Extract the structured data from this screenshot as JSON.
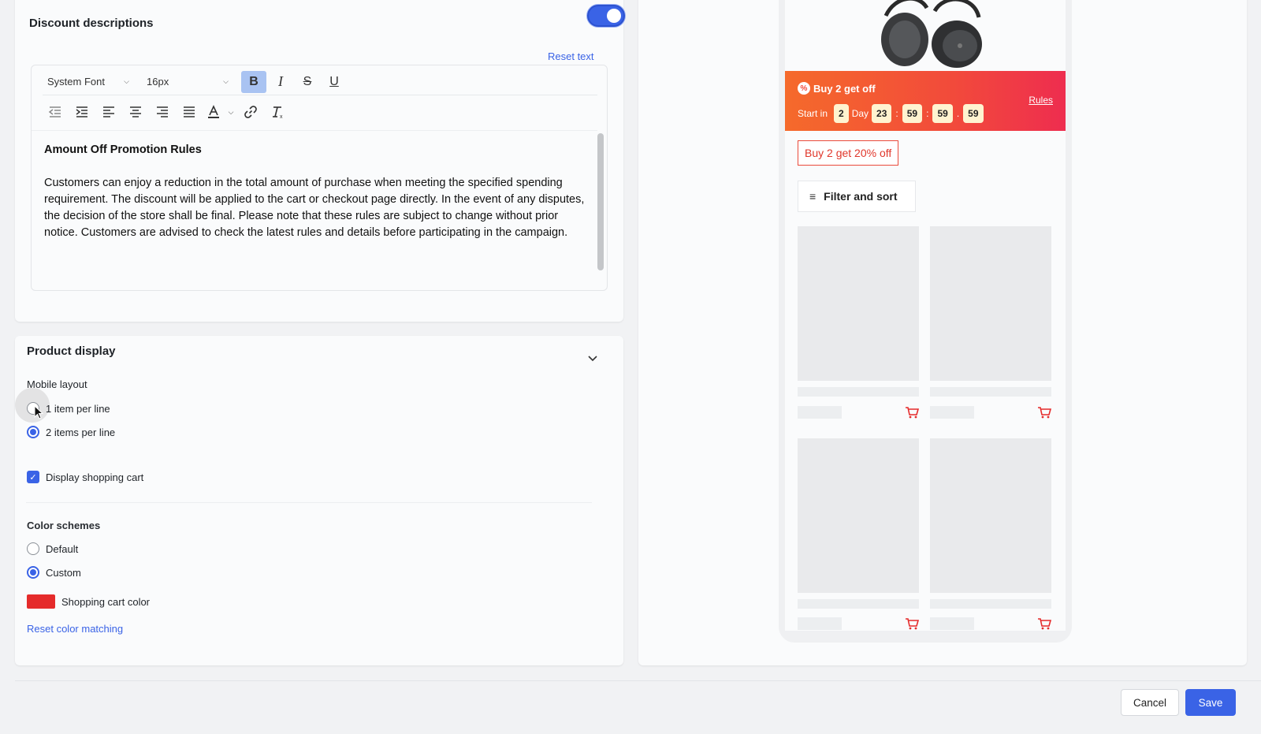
{
  "discount": {
    "title": "Discount descriptions",
    "toggle_on": true,
    "reset_text": "Reset text"
  },
  "editor": {
    "font": "System Font",
    "size": "16px",
    "heading": "Amount Off Promotion Rules",
    "body": "Customers can enjoy a reduction in the total amount of purchase when meeting the specified spending requirement. The discount will be applied to the cart or checkout page directly. In the event of any disputes, the decision of the store shall be final. Please note that these rules are subject to change without prior notice. Customers are advised to check the latest rules and details before participating in the campaign.",
    "toolbar_icons": [
      "bold-icon",
      "italic-icon",
      "strikethrough-icon",
      "underline-icon",
      "outdent-icon",
      "indent-icon",
      "align-left-icon",
      "align-center-icon",
      "align-right-icon",
      "justify-icon",
      "text-color-icon",
      "link-icon",
      "clear-format-icon"
    ]
  },
  "product": {
    "title": "Product display",
    "mobile_layout_label": "Mobile layout",
    "layout_options": [
      {
        "label": "1 item per line",
        "selected": false
      },
      {
        "label": "2 items per line",
        "selected": true
      }
    ],
    "display_cart_label": "Display shopping cart",
    "display_cart_checked": true,
    "color_schemes_label": "Color schemes",
    "color_options": [
      {
        "label": "Default",
        "selected": false
      },
      {
        "label": "Custom",
        "selected": true
      }
    ],
    "cart_color_label": "Shopping cart color",
    "cart_color": "#e52b2b",
    "reset_color": "Reset color matching"
  },
  "preview": {
    "promo_title": "Buy 2 get off",
    "rules": "Rules",
    "start_in": "Start in",
    "days": "2",
    "day_label": "Day",
    "hours": "23",
    "minutes": "59",
    "seconds": "59",
    "centis": "59",
    "offer_tag": "Buy 2 get 20% off",
    "filter_sort": "Filter and sort"
  },
  "footer": {
    "cancel": "Cancel",
    "save": "Save"
  },
  "colors": {
    "accent": "#3a63e6",
    "promo_start": "#f56a2b",
    "promo_end": "#ee2d4f",
    "cart_red": "#e52b2b"
  }
}
